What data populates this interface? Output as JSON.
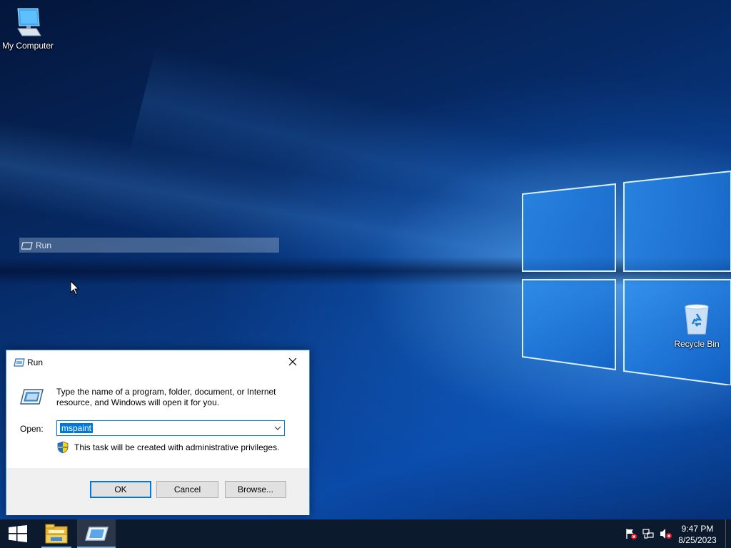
{
  "desktop": {
    "icons": [
      {
        "label": "My Computer",
        "icon": "computer-icon"
      },
      {
        "label": "Recycle Bin",
        "icon": "recycle-bin-icon"
      }
    ]
  },
  "drag_ghost": {
    "label": "Run"
  },
  "dialog": {
    "title": "Run",
    "description": "Type the name of a program, folder, document, or Internet resource, and Windows will open it for you.",
    "open_label": "Open:",
    "open_value": "mspaint",
    "admin_note": "This task will be created with administrative privileges.",
    "buttons": {
      "ok": "OK",
      "cancel": "Cancel",
      "browse": "Browse..."
    }
  },
  "taskbar": {
    "items": [
      {
        "name": "start",
        "icon": "windows-logo-icon"
      },
      {
        "name": "File Explorer",
        "icon": "folder-icon"
      },
      {
        "name": "Run",
        "icon": "run-icon",
        "active": true
      }
    ],
    "tray_icons": [
      "action-center-flag-icon",
      "network-icon",
      "volume-muted-icon"
    ],
    "clock": {
      "time": "9:47 PM",
      "date": "8/25/2023"
    }
  },
  "colors": {
    "accent": "#0078d7",
    "taskbar": "#0c1a2e",
    "dialog_footer": "#f0f0f0"
  }
}
